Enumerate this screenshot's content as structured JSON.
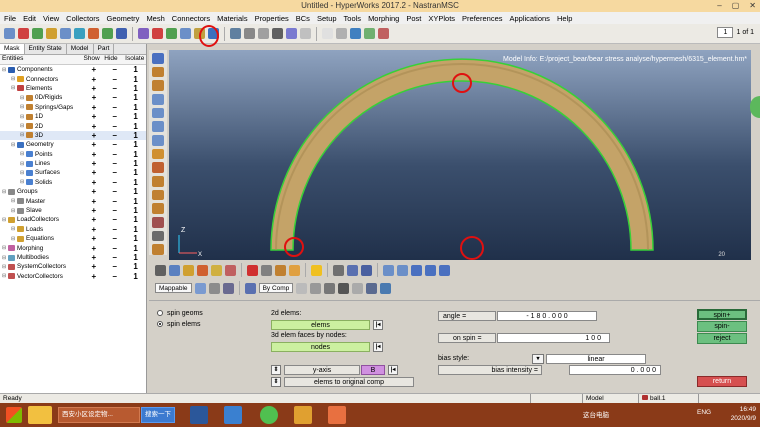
{
  "window": {
    "title": "Untitled - HyperWorks 2017.2 - NastranMSC",
    "controls": [
      "–",
      "▢",
      "✕"
    ]
  },
  "menu": [
    "File",
    "Edit",
    "View",
    "Collectors",
    "Geometry",
    "Mesh",
    "Connectors",
    "Materials",
    "Properties",
    "BCs",
    "Setup",
    "Tools",
    "Morphing",
    "Post",
    "XYPlots",
    "Preferences",
    "Applications",
    "Help"
  ],
  "toolbar": {
    "page_current": "1",
    "page_of": "1 of 1"
  },
  "browser": {
    "tabs": [
      "Mask",
      "Entity State",
      "Model",
      "Part"
    ],
    "headers": {
      "entities": "Entities",
      "show": "Show",
      "hide": "Hide",
      "isolate": "Isolate"
    },
    "rows": [
      {
        "label": "Components",
        "indent": 0,
        "color": "#2a5db0",
        "show": "+",
        "hide": "–",
        "iso": "1"
      },
      {
        "label": "Connectors",
        "indent": 1,
        "color": "#e0a020",
        "show": "+",
        "hide": "–",
        "iso": "1"
      },
      {
        "label": "Elements",
        "indent": 1,
        "color": "#c04040",
        "show": "+",
        "hide": "–",
        "iso": "1"
      },
      {
        "label": "0D/Rigids",
        "indent": 2,
        "color": "#c08030",
        "show": "+",
        "hide": "–",
        "iso": "1"
      },
      {
        "label": "Springs/Gaps",
        "indent": 2,
        "color": "#c08030",
        "show": "+",
        "hide": "–",
        "iso": "1"
      },
      {
        "label": "1D",
        "indent": 2,
        "color": "#c08030",
        "show": "+",
        "hide": "–",
        "iso": "1"
      },
      {
        "label": "2D",
        "indent": 2,
        "color": "#c08030",
        "show": "+",
        "hide": "–",
        "iso": "1"
      },
      {
        "label": "3D",
        "indent": 2,
        "color": "#c08030",
        "show": "+",
        "hide": "–",
        "iso": "1",
        "selected": true
      },
      {
        "label": "Geometry",
        "indent": 1,
        "color": "#3a70c0",
        "show": "+",
        "hide": "–",
        "iso": "1"
      },
      {
        "label": "Points",
        "indent": 2,
        "color": "#4a80d0",
        "show": "+",
        "hide": "–",
        "iso": "1"
      },
      {
        "label": "Lines",
        "indent": 2,
        "color": "#4a80d0",
        "show": "+",
        "hide": "–",
        "iso": "1"
      },
      {
        "label": "Surfaces",
        "indent": 2,
        "color": "#4a80d0",
        "show": "+",
        "hide": "–",
        "iso": "1"
      },
      {
        "label": "Solids",
        "indent": 2,
        "color": "#4a80d0",
        "show": "+",
        "hide": "–",
        "iso": "1"
      },
      {
        "label": "Groups",
        "indent": 0,
        "color": "#888888",
        "show": "+",
        "hide": "–",
        "iso": "1"
      },
      {
        "label": "Master",
        "indent": 1,
        "color": "#888888",
        "show": "+",
        "hide": "–",
        "iso": "1"
      },
      {
        "label": "Slave",
        "indent": 1,
        "color": "#888888",
        "show": "+",
        "hide": "–",
        "iso": "1"
      },
      {
        "label": "LoadCollectors",
        "indent": 0,
        "color": "#d0a030",
        "show": "+",
        "hide": "–",
        "iso": "1"
      },
      {
        "label": "Loads",
        "indent": 1,
        "color": "#d0a030",
        "show": "+",
        "hide": "–",
        "iso": "1"
      },
      {
        "label": "Equations",
        "indent": 1,
        "color": "#d0a030",
        "show": "+",
        "hide": "–",
        "iso": "1"
      },
      {
        "label": "Morphing",
        "indent": 0,
        "color": "#c060a0",
        "show": "+",
        "hide": "–",
        "iso": "1"
      },
      {
        "label": "Multibodies",
        "indent": 0,
        "color": "#60a0c0",
        "show": "+",
        "hide": "–",
        "iso": "1"
      },
      {
        "label": "SystemCollectors",
        "indent": 0,
        "color": "#c05050",
        "show": "+",
        "hide": "–",
        "iso": "1"
      },
      {
        "label": "VectorCollectors",
        "indent": 0,
        "color": "#c05050",
        "show": "+",
        "hide": "–",
        "iso": "1"
      }
    ]
  },
  "graphics": {
    "model_info": "Model Info: E:/project_bear/bear stress analyse/hypermesh/6315_element.hm*",
    "axis_z": "Z",
    "axis_x": "X",
    "scale": "20"
  },
  "lower_toolbar": {
    "mappable": "Mappable",
    "by_comp": "By Comp"
  },
  "panel": {
    "spin_geoms": "spin geoms",
    "spin_elems": "spin elems",
    "elems_2d_label": "2d elems:",
    "elems_btn": "elems",
    "faces_3d_label": "3d elem faces by nodes:",
    "nodes_btn": "nodes",
    "yaxis_label": "y-axis",
    "b_btn": "B",
    "orig_comp": "elems to original comp",
    "angle_label": "angle =",
    "angle_value": "- 1 8 0 . 0 0 0",
    "on_spin_label": "on spin =",
    "on_spin_value": "1 0 0",
    "bias_style_label": "bias style:",
    "bias_style_value": "linear",
    "bias_intensity_label": "bias intensity =",
    "bias_intensity_value": "0 . 0 0 0",
    "spin_plus": "spin+",
    "spin_minus": "spin-",
    "reject": "reject",
    "return": "return"
  },
  "status": {
    "ready": "Ready",
    "model": "Model",
    "comp": "ball.1"
  },
  "taskbar": {
    "item1": "西安小区设定物...",
    "item2": "搜索一下",
    "tray": "这台电脑",
    "ime": "ENG",
    "time": "16:49",
    "date": "2020/9/9"
  },
  "colors": {
    "accent_green": "#ccf0a0",
    "model_fill": "#c4a368",
    "model_edge": "#38d038",
    "annotation_red": "#e01010"
  }
}
